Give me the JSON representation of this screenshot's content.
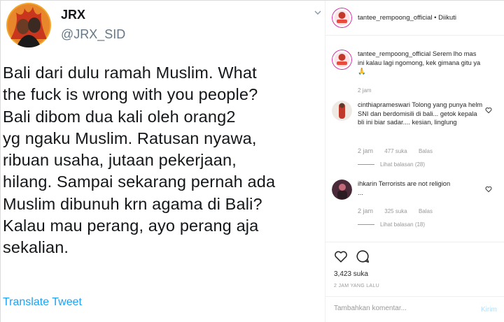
{
  "tweet": {
    "name": "JRX",
    "handle": "@JRX_SID",
    "lines": [
      "Bali dari dulu ramah Muslim. What",
      "the fuck is wrong with you people?",
      "Bali dibom dua kali oleh orang2",
      "yg ngaku Muslim. Ratusan nyawa,",
      "ribuan usaha, jutaan pekerjaan,",
      "hilang. Sampai sekarang pernah ada",
      "Muslim dibunuh krn agama di Bali?",
      "Kalau mau perang, ayo perang aja",
      "sekalian."
    ],
    "translate_label": "Translate Tweet",
    "colors": {
      "text": "#14171a",
      "handle": "#657786",
      "link": "#1da1f2"
    }
  },
  "instagram": {
    "header": {
      "username": "tantee_rempoong_official",
      "separator": "•",
      "follow_label": "Diikuti"
    },
    "caption": {
      "username": "tantee_rempoong_official",
      "text": "Serem lho mas ini kalau lagi ngomong, kek gimana gitu ya 🙏",
      "time": "2 jam"
    },
    "comments": [
      {
        "username": "cinthiaprameswari",
        "text": "Tolong yang punya helm SNI dan berdomisili di bali... getok kepala bli ini biar sadar.... kesian, linglung",
        "time": "2 jam",
        "likes": "477 suka",
        "reply_label": "Balas",
        "view_replies": "Lihat balasan (28)"
      },
      {
        "username": "ihkarin",
        "text": "Terrorists are not religion",
        "extra": "...",
        "time": "2 jam",
        "likes": "325 suka",
        "reply_label": "Balas",
        "view_replies": "Lihat balasan (18)"
      }
    ],
    "likes_count": "3,423 suka",
    "post_time": "2 JAM YANG LALU",
    "comment_placeholder": "Tambahkan komentar...",
    "post_label": "Kirim",
    "icons": [
      "heart-icon",
      "comment-icon"
    ]
  }
}
